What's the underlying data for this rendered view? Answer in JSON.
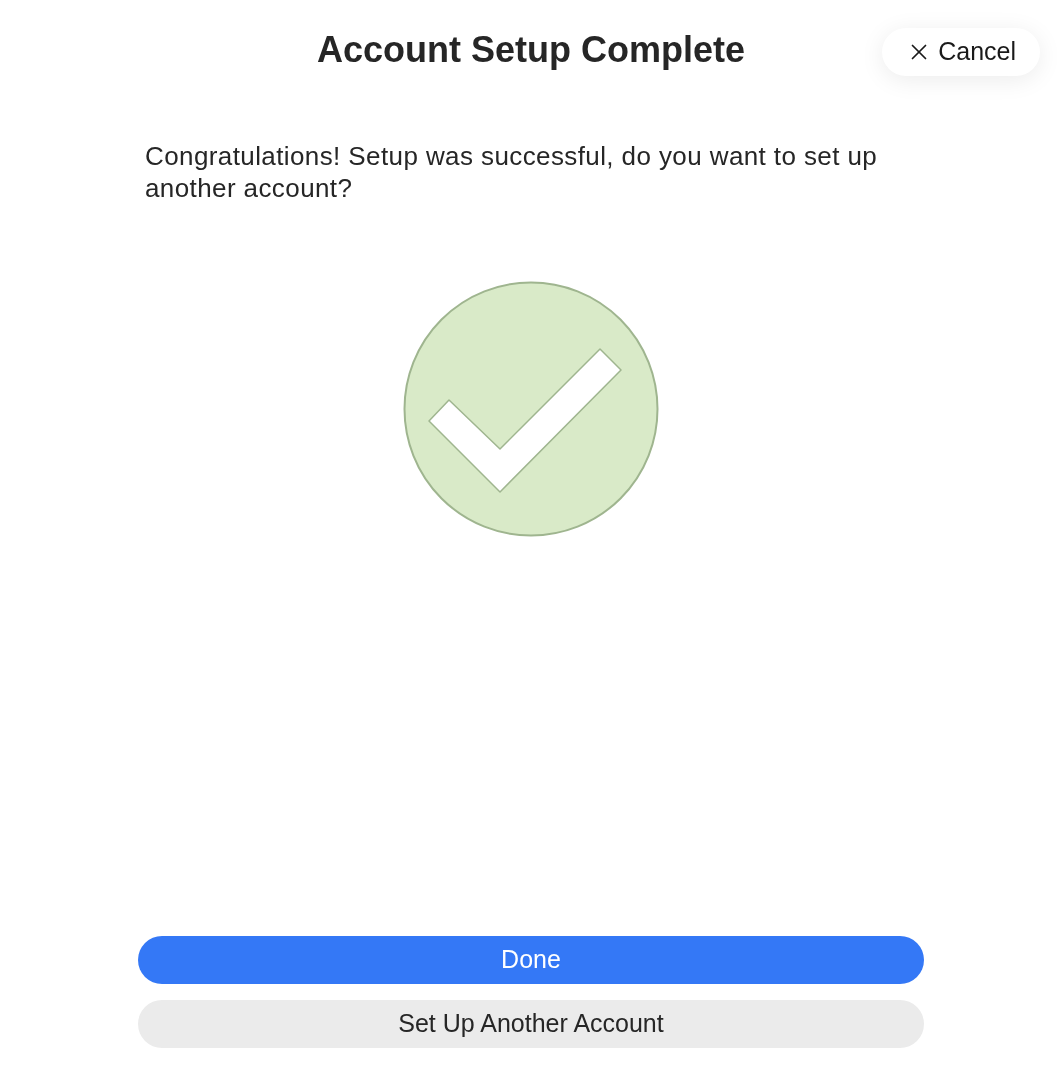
{
  "header": {
    "title": "Account Setup Complete",
    "cancel_button": {
      "label": "Cancel"
    }
  },
  "message": "Congratulations! Setup was successful, do you want to set up another account?",
  "buttons": [
    {
      "label": "Done",
      "kind": "primary"
    },
    {
      "label": "Set Up Another Account",
      "kind": "secondary"
    }
  ]
}
